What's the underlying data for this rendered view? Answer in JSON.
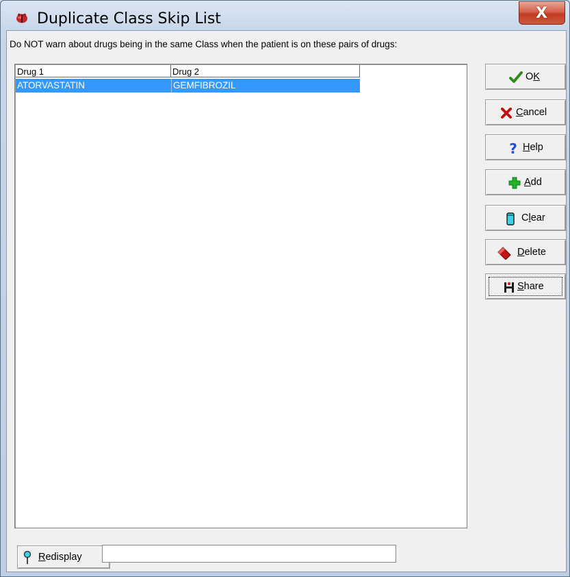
{
  "window": {
    "title": "Duplicate Class Skip List",
    "close_glyph": "X"
  },
  "instruction": "Do NOT warn about drugs being in the same Class when the patient is on these pairs of drugs:",
  "table": {
    "columns": [
      "Drug 1",
      "Drug 2"
    ],
    "rows": [
      {
        "drug1": "ATORVASTATIN",
        "drug2": "GEMFIBROZIL",
        "selected": true
      }
    ]
  },
  "buttons": {
    "ok": {
      "pre": "O",
      "accel": "K",
      "post": "",
      "icon": "check-icon"
    },
    "cancel": {
      "pre": "",
      "accel": "C",
      "post": "ancel",
      "icon": "red-x-icon"
    },
    "help": {
      "pre": "",
      "accel": "H",
      "post": "elp",
      "icon": "question-icon"
    },
    "add": {
      "pre": "",
      "accel": "A",
      "post": "dd",
      "icon": "green-plus-icon"
    },
    "clear": {
      "pre": "C",
      "accel": "l",
      "post": "ear",
      "icon": "cylinder-icon"
    },
    "delete": {
      "pre": "",
      "accel": "D",
      "post": "elete",
      "icon": "eraser-icon"
    },
    "share": {
      "pre": "",
      "accel": "S",
      "post": "hare",
      "icon": "share-icon"
    }
  },
  "bottom": {
    "redisplay": {
      "pre": "",
      "accel": "R",
      "post": "edisplay",
      "icon": "pin-icon"
    },
    "input_value": ""
  },
  "colors": {
    "selection": "#3399ff",
    "close_button": "#c23b22"
  }
}
